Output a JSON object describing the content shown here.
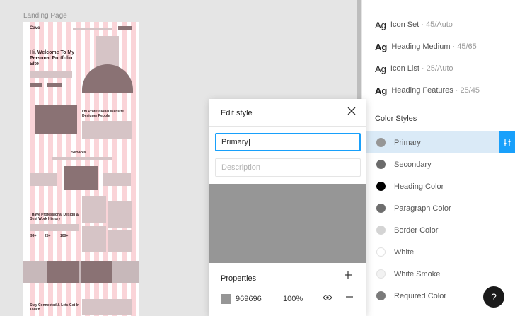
{
  "canvas": {
    "frame_label": "Landing Page",
    "mock": {
      "logo": "Cavo",
      "hero_title": "Hi, Welcome To My Personal Portfolio Site",
      "professional_title": "I'm Professional Website Designer People",
      "services_title": "Services",
      "history_title": "I Have Professional Design & Best Work History",
      "stats": [
        "99+",
        "25+",
        "100+"
      ],
      "contact_title": "Stay Connected & Lets Get In Touch"
    }
  },
  "text_styles": [
    {
      "ag": "Ag",
      "name": "Icon Set",
      "size": "· 45/Auto",
      "bold": false
    },
    {
      "ag": "Ag",
      "name": "Heading Medium",
      "size": "· 45/65",
      "bold": true
    },
    {
      "ag": "Ag",
      "name": "Icon List",
      "size": "· 25/Auto",
      "bold": false
    },
    {
      "ag": "Ag",
      "name": "Heading Features",
      "size": "· 25/45",
      "bold": true
    }
  ],
  "color_styles": {
    "title": "Color Styles",
    "items": [
      {
        "name": "Primary",
        "color": "#969696"
      },
      {
        "name": "Secondary",
        "color": "#6b6b6b"
      },
      {
        "name": "Heading Color",
        "color": "#000000"
      },
      {
        "name": "Paragraph Color",
        "color": "#6e6e6e"
      },
      {
        "name": "Border Color",
        "color": "#d4d4d4"
      },
      {
        "name": "White",
        "color": "#ffffff"
      },
      {
        "name": "White Smoke",
        "color": "#f2f2f2"
      },
      {
        "name": "Required Color",
        "color": "#7a7a7a"
      }
    ]
  },
  "dialog": {
    "title": "Edit style",
    "name_value": "Primary",
    "description_placeholder": "Description",
    "preview_color": "#969696",
    "properties_title": "Properties",
    "fill_hex": "969696",
    "fill_opacity": "100%"
  },
  "help": "?"
}
